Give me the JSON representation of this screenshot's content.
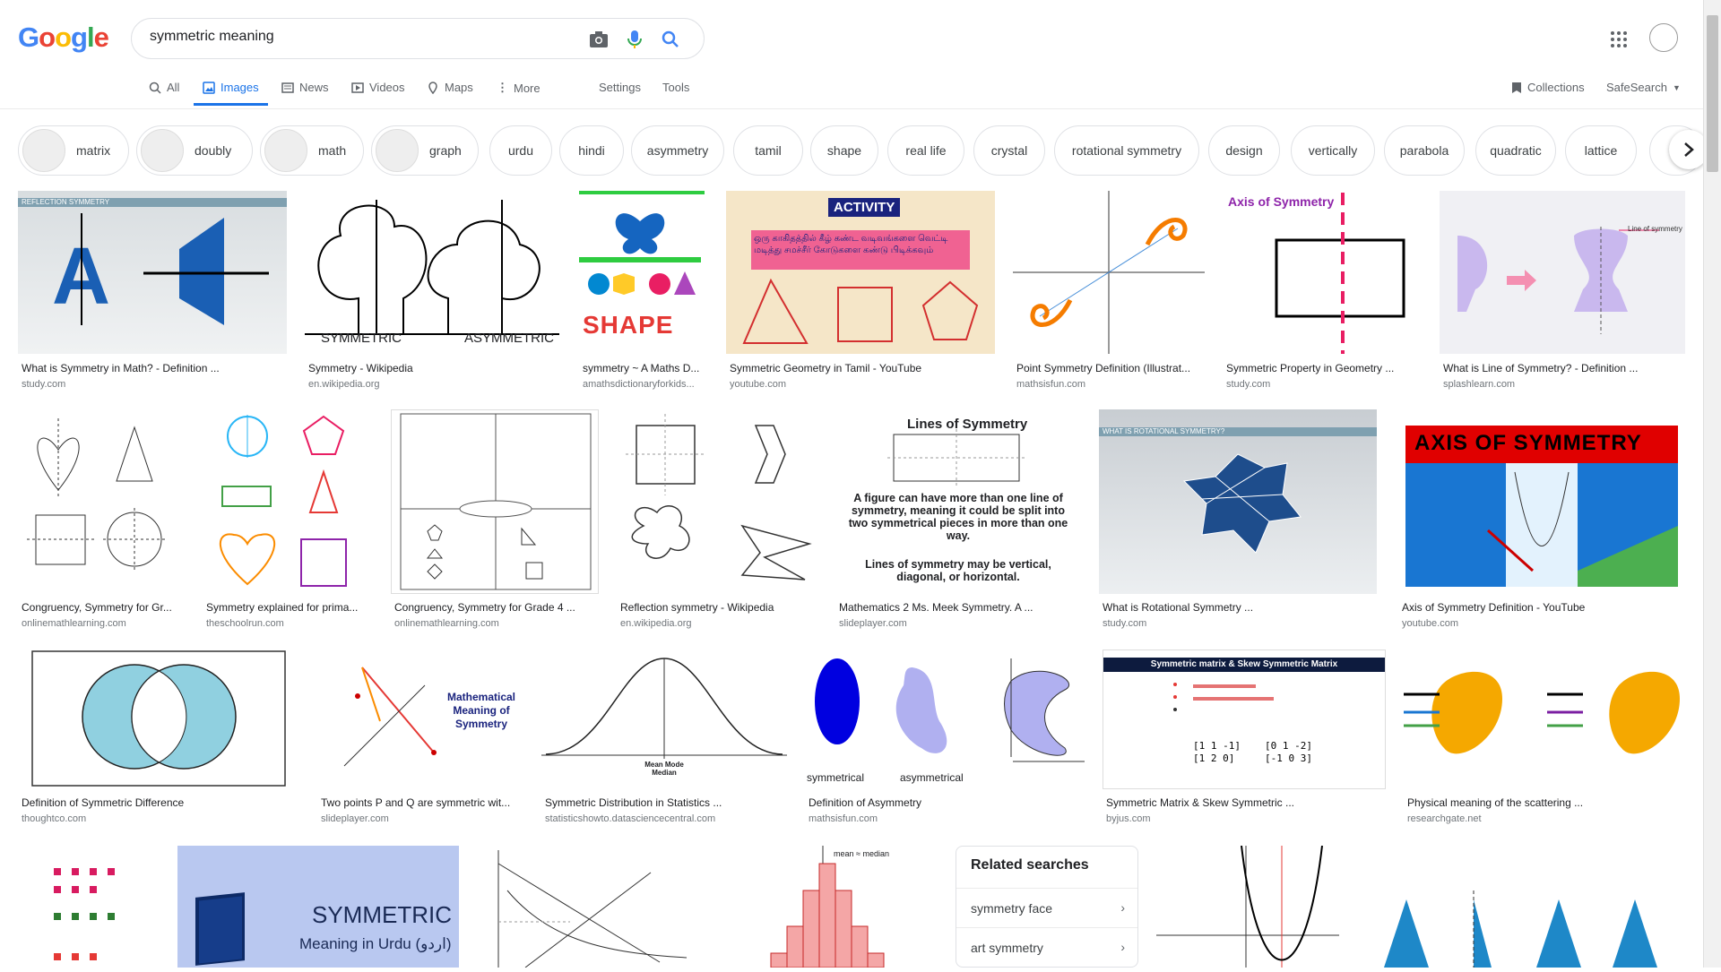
{
  "logo": "Google",
  "search": {
    "value": "symmetric meaning"
  },
  "tabs": [
    {
      "label": "All"
    },
    {
      "label": "Images"
    },
    {
      "label": "News"
    },
    {
      "label": "Videos"
    },
    {
      "label": "Maps"
    },
    {
      "label": "More"
    }
  ],
  "tools": {
    "settings": "Settings",
    "tools": "Tools",
    "collections": "Collections",
    "safesearch": "SafeSearch"
  },
  "chips": [
    "matrix",
    "doubly",
    "math",
    "graph",
    "urdu",
    "hindi",
    "asymmetry",
    "tamil",
    "shape",
    "real life",
    "crystal",
    "rotational symmetry",
    "design",
    "vertically",
    "parabola",
    "quadratic",
    "lattice"
  ],
  "results": [
    {
      "title": "What is Symmetry in Math? - Definition ...",
      "source": "study.com"
    },
    {
      "title": "Symmetry - Wikipedia",
      "source": "en.wikipedia.org"
    },
    {
      "title": "symmetry ~ A Maths D...",
      "source": "amathsdictionaryforkids..."
    },
    {
      "title": "Symmetric Geometry in Tamil - YouTube",
      "source": "youtube.com"
    },
    {
      "title": "Point Symmetry Definition (Illustrat...",
      "source": "mathsisfun.com"
    },
    {
      "title": "Symmetric Property in Geometry ...",
      "source": "study.com"
    },
    {
      "title": "What is Line of Symmetry? - Definition ...",
      "source": "splashlearn.com"
    },
    {
      "title": "Congruency, Symmetry for Gr...",
      "source": "onlinemathlearning.com"
    },
    {
      "title": "Symmetry explained for prima...",
      "source": "theschoolrun.com"
    },
    {
      "title": "Congruency, Symmetry for Grade 4 ...",
      "source": "onlinemathlearning.com"
    },
    {
      "title": "Reflection symmetry - Wikipedia",
      "source": "en.wikipedia.org"
    },
    {
      "title": "Mathematics 2 Ms. Meek Symmetry. A ...",
      "source": "slideplayer.com"
    },
    {
      "title": "What is Rotational Symmetry ...",
      "source": "study.com"
    },
    {
      "title": "Axis of Symmetry Definition - YouTube",
      "source": "youtube.com"
    },
    {
      "title": "Definition of Symmetric Difference",
      "source": "thoughtco.com"
    },
    {
      "title": "Two points P and Q are symmetric wit...",
      "source": "slideplayer.com"
    },
    {
      "title": "Symmetric Distribution in Statistics ...",
      "source": "statisticshowto.datasciencecentral.com"
    },
    {
      "title": "Definition of Asymmetry",
      "source": "mathsisfun.com"
    },
    {
      "title": "Symmetric Matrix & Skew Symmetric ...",
      "source": "byjus.com"
    },
    {
      "title": "Physical meaning of the scattering ...",
      "source": "researchgate.net"
    }
  ],
  "thumb_text": {
    "refl": "REFLECTION SYMMETRY",
    "a": "A",
    "sym": "SYMMETRIC",
    "asym": "ASYMMETRIC",
    "shape": "SHAPE",
    "activity": "ACTIVITY",
    "tamil": "ஒரு காகிதத்தில் கீழ் கண்ட வடிவங்களை வெட்டி மடித்து சமச்சீர் கோடுகளை கண்டு பிடிக்கவும்",
    "axis": "Axis of Symmetry",
    "lineof": "Line of symmetry",
    "linesof": "Lines of Symmetry",
    "linesbody1": "A figure can have more than one line of symmetry, meaning it could be split into two symmetrical pieces in more than one way.",
    "linesbody2": "Lines of symmetry may be vertical, diagonal, or horizontal.",
    "rot": "WHAT IS ROTATIONAL SYMMETRY?",
    "axisyt": "AXIS OF SYMMETRY",
    "mms": "Mathematical Meaning of Symmetry",
    "mean": "Mean Mode Median",
    "symm": "symmetrical",
    "asymm": "asymmetrical",
    "matrix": "Symmetric matrix & Skew Symmetric Matrix",
    "urdu1": "SYMMETRIC",
    "urdu2": "Meaning in Urdu (اردو)",
    "meaneq": "mean ≈ median"
  },
  "related": {
    "heading": "Related searches",
    "items": [
      "symmetry face",
      "art symmetry"
    ]
  }
}
